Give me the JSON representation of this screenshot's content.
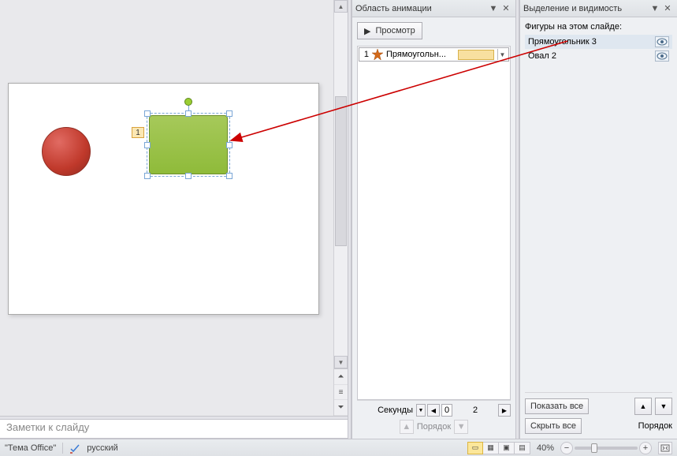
{
  "animation_pane": {
    "title": "Область анимации",
    "preview_button": "Просмотр",
    "items": [
      {
        "index": "1",
        "name": "Прямоугольн..."
      }
    ],
    "timeline": {
      "label": "Секунды",
      "values": [
        "0",
        "2"
      ]
    },
    "reorder_label": "Порядок"
  },
  "selection_pane": {
    "title": "Выделение и видимость",
    "caption": "Фигуры на этом слайде:",
    "shapes": [
      {
        "name": "Прямоугольник 3",
        "selected": true
      },
      {
        "name": "Овал 2",
        "selected": false
      }
    ],
    "show_all": "Показать все",
    "hide_all": "Скрыть все",
    "reorder_label": "Порядок"
  },
  "canvas": {
    "anim_tag": "1"
  },
  "notes": {
    "placeholder": "Заметки к слайду"
  },
  "statusbar": {
    "theme": "\"Тема Office\"",
    "language": "русский",
    "zoom": "40%"
  }
}
